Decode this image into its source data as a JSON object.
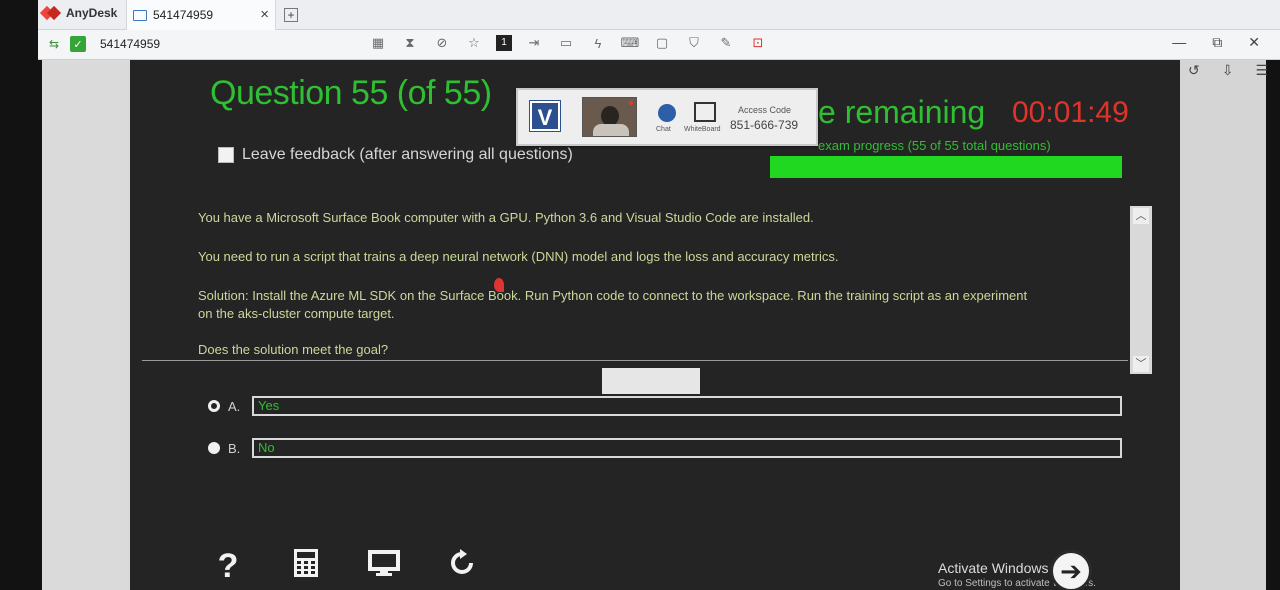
{
  "anydesk": {
    "brand": "AnyDesk",
    "tab_label": "541474959",
    "tab_close": "×",
    "new_tab": "+",
    "toolbar_id": "541474959",
    "toolbar_session_number": "1"
  },
  "exam": {
    "title": "Question 55 (of 55)",
    "time_label": "e remaining",
    "timer": "00:01:49",
    "progress_label": "exam progress (55 of 55 total questions)",
    "progress_fraction": 1.0,
    "feedback_label": "Leave feedback (after answering all questions)",
    "question_lines": [
      "You have a Microsoft Surface Book computer with a GPU. Python 3.6 and Visual Studio Code are installed.",
      "You need to run a script that trains a deep neural network (DNN) model and logs the loss and accuracy metrics.",
      "Solution: Install the Azure ML SDK on the Surface Book. Run Python code to connect to the workspace. Run the training script as an experiment",
      "on the aks-cluster compute target.",
      "Does the solution meet the goal?"
    ],
    "answers": [
      {
        "letter": "A.",
        "text": "Yes",
        "selected": true
      },
      {
        "letter": "B.",
        "text": "No",
        "selected": false
      }
    ],
    "bottom_icons": [
      "help-icon",
      "calculator-icon",
      "monitor-icon",
      "refresh-icon"
    ],
    "help_glyph": "?"
  },
  "overlay_panel": {
    "access_code_label": "Access Code",
    "access_code": "851-666-739",
    "chat_label": "Chat",
    "whiteboard_label": "WhiteBoard",
    "vendor_glyph": "V"
  },
  "windows": {
    "activate_title": "Activate Windows",
    "activate_sub": "Go to Settings to activate Windows."
  },
  "colors": {
    "accent_green": "#2fbf32",
    "timer_red": "#e0342b",
    "progress_green": "#20d820"
  }
}
